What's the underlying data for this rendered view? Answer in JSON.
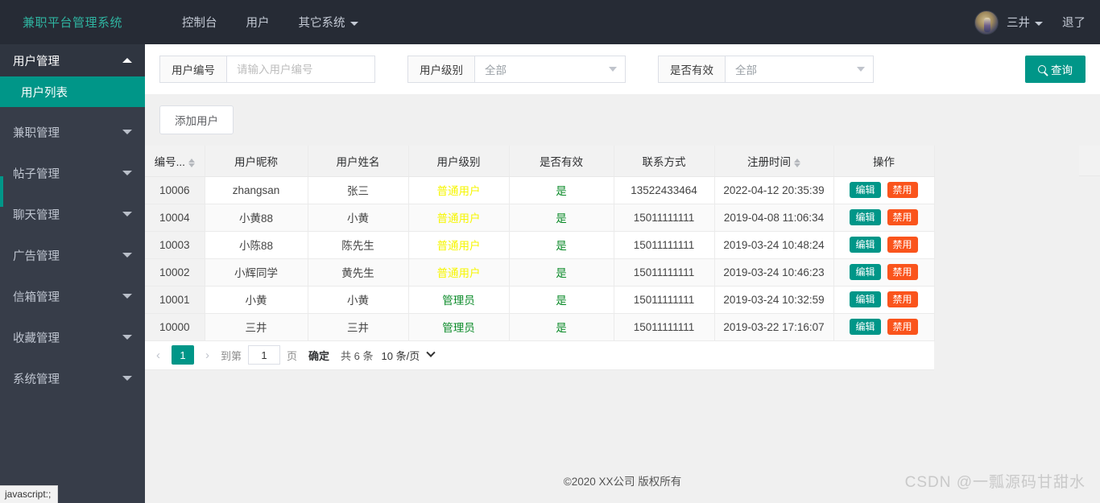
{
  "topnav": {
    "brand": "兼职平台管理系统",
    "links": [
      {
        "label": "控制台",
        "has_caret": false
      },
      {
        "label": "用户",
        "has_caret": false
      },
      {
        "label": "其它系统",
        "has_caret": true
      }
    ],
    "avatar_icon": "user-avatar-icon",
    "username": "三井",
    "logout": "退了"
  },
  "sidebar": {
    "items": [
      {
        "label": "用户管理",
        "state": "open",
        "arrow": "up"
      },
      {
        "label": "用户列表",
        "state": "active",
        "arrow": ""
      },
      {
        "label": "兼职管理",
        "state": "collapsed",
        "arrow": "down"
      },
      {
        "label": "帖子管理",
        "state": "collapsed",
        "arrow": "down"
      },
      {
        "label": "聊天管理",
        "state": "collapsed",
        "arrow": "down"
      },
      {
        "label": "广告管理",
        "state": "collapsed",
        "arrow": "down"
      },
      {
        "label": "信箱管理",
        "state": "collapsed",
        "arrow": "down"
      },
      {
        "label": "收藏管理",
        "state": "collapsed",
        "arrow": "down"
      },
      {
        "label": "系统管理",
        "state": "collapsed",
        "arrow": "down"
      }
    ]
  },
  "filters": {
    "user_id": {
      "label": "用户编号",
      "placeholder": "请输入用户编号",
      "value": ""
    },
    "user_level": {
      "label": "用户级别",
      "value": "全部"
    },
    "is_valid": {
      "label": "是否有效",
      "value": "全部"
    },
    "query_button": "查询",
    "query_icon": "search-icon"
  },
  "toolbar": {
    "add_user": "添加用户"
  },
  "table": {
    "headers": [
      {
        "label": "编号...",
        "sortable": true
      },
      {
        "label": "用户昵称",
        "sortable": false
      },
      {
        "label": "用户姓名",
        "sortable": false
      },
      {
        "label": "用户级别",
        "sortable": false
      },
      {
        "label": "是否有效",
        "sortable": false
      },
      {
        "label": "联系方式",
        "sortable": false
      },
      {
        "label": "注册时间",
        "sortable": true
      },
      {
        "label": "操作",
        "sortable": false
      }
    ],
    "rows": [
      {
        "id": "10006",
        "nickname": "zhangsan",
        "name": "张三",
        "level": "普通用户",
        "level_type": "normal",
        "valid": "是",
        "phone": "13522433464",
        "time": "2022-04-12 20:35:39"
      },
      {
        "id": "10004",
        "nickname": "小黄88",
        "name": "小黄",
        "level": "普通用户",
        "level_type": "normal",
        "valid": "是",
        "phone": "15011111111",
        "time": "2019-04-08 11:06:34"
      },
      {
        "id": "10003",
        "nickname": "小陈88",
        "name": "陈先生",
        "level": "普通用户",
        "level_type": "normal",
        "valid": "是",
        "phone": "15011111111",
        "time": "2019-03-24 10:48:24"
      },
      {
        "id": "10002",
        "nickname": "小辉同学",
        "name": "黄先生",
        "level": "普通用户",
        "level_type": "normal",
        "valid": "是",
        "phone": "15011111111",
        "time": "2019-03-24 10:46:23"
      },
      {
        "id": "10001",
        "nickname": "小黄",
        "name": "小黄",
        "level": "管理员",
        "level_type": "admin",
        "valid": "是",
        "phone": "15011111111",
        "time": "2019-03-24 10:32:59"
      },
      {
        "id": "10000",
        "nickname": "三井",
        "name": "三井",
        "level": "管理员",
        "level_type": "admin",
        "valid": "是",
        "phone": "15011111111",
        "time": "2019-03-22 17:16:07"
      }
    ],
    "row_actions": {
      "edit": "编辑",
      "ban": "禁用"
    }
  },
  "pagination": {
    "prev_icon": "chevron-left-icon",
    "next_icon": "chevron-right-icon",
    "current_page": "1",
    "goto_prefix": "到第",
    "goto_value": "1",
    "goto_suffix": "页",
    "confirm": "确定",
    "total": "共 6 条",
    "page_size": "10 条/页"
  },
  "footer": {
    "copyright": "©2020 XX公司 版权所有",
    "watermark": "CSDN @一瓢源码甘甜水"
  },
  "statusbar": {
    "text": "javascript:;"
  },
  "colors": {
    "accent": "#009688",
    "nav_bg": "#262b35",
    "sidebar_bg": "#373d49",
    "level_normal": "#f6f600",
    "level_admin": "#0a8a28",
    "ban": "#fa541c"
  }
}
